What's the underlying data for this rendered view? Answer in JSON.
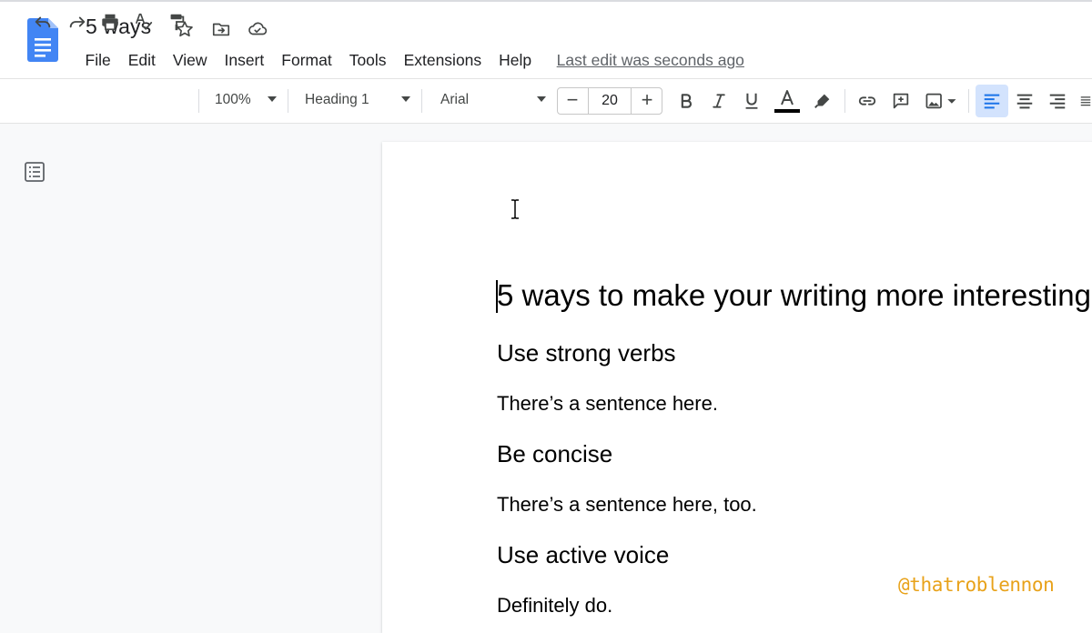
{
  "app": {
    "title": "5 ways",
    "last_edit": "Last edit was seconds ago"
  },
  "menu": [
    "File",
    "Edit",
    "View",
    "Insert",
    "Format",
    "Tools",
    "Extensions",
    "Help"
  ],
  "toolbar": {
    "zoom": "100%",
    "style": "Heading 1",
    "font": "Arial",
    "font_size": "20",
    "minus": "−",
    "plus": "+"
  },
  "document": {
    "title": "5 ways to make your writing more interesting",
    "sections": [
      {
        "heading": "Use strong verbs",
        "body": "There’s a sentence here."
      },
      {
        "heading": "Be concise",
        "body": "There’s a sentence here, too."
      },
      {
        "heading": "Use active voice",
        "body": "Definitely do."
      }
    ]
  },
  "watermark": "@thatroblennon",
  "colors": {
    "accent_blue": "#1a73e8",
    "active_align_bg": "#d3e3fd",
    "watermark": "#e8a21a"
  }
}
